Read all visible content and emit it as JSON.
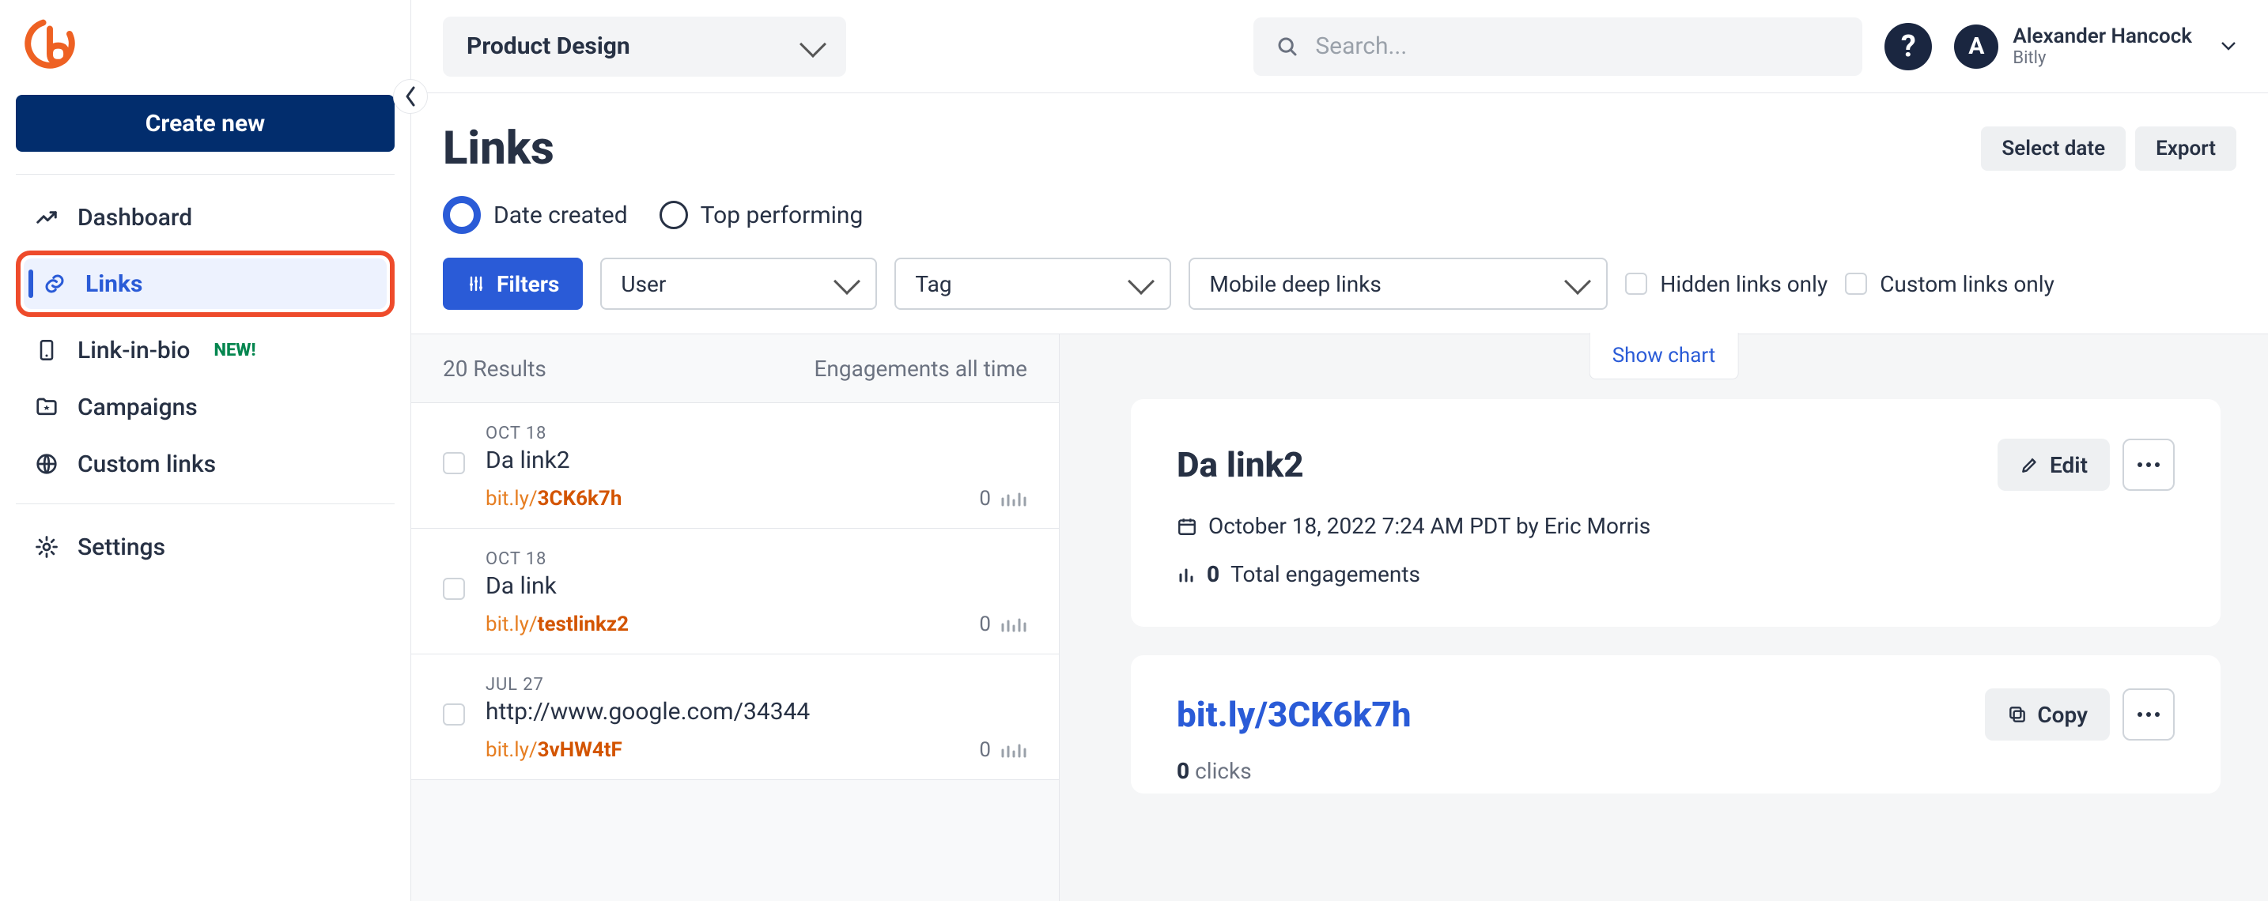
{
  "sidebar": {
    "create_label": "Create new",
    "nav": {
      "dashboard": "Dashboard",
      "links": "Links",
      "linkinbio": "Link-in-bio",
      "linkinbio_badge": "NEW!",
      "campaigns": "Campaigns",
      "custom": "Custom links",
      "settings": "Settings"
    }
  },
  "topbar": {
    "org": "Product Design",
    "search_placeholder": "Search...",
    "user_name": "Alexander Hancock",
    "user_org": "Bitly",
    "avatar_initial": "A"
  },
  "page": {
    "title": "Links",
    "select_date": "Select date",
    "export": "Export",
    "sort": {
      "date_created": "Date created",
      "top_performing": "Top performing"
    },
    "filters_btn": "Filters",
    "dropdowns": {
      "user": "User",
      "tag": "Tag",
      "mdl": "Mobile deep links"
    },
    "hidden_only": "Hidden links only",
    "custom_only": "Custom links only"
  },
  "list": {
    "results": "20 Results",
    "eng_header": "Engagements all time",
    "short_prefix": "bit.ly/",
    "items": [
      {
        "date": "OCT 18",
        "title": "Da link2",
        "key": "3CK6k7h",
        "eng": "0"
      },
      {
        "date": "OCT 18",
        "title": "Da link",
        "key": "testlinkz2",
        "eng": "0"
      },
      {
        "date": "JUL 27",
        "title": "http://www.google.com/34344",
        "key": "3vHW4tF",
        "eng": "0"
      }
    ]
  },
  "detail": {
    "show_chart": "Show chart",
    "title": "Da link2",
    "edit": "Edit",
    "created": "October 18, 2022 7:24 AM PDT by Eric Morris",
    "total_eng_n": "0",
    "total_eng_label": "Total engagements",
    "short_link": "bit.ly/3CK6k7h",
    "copy": "Copy",
    "clicks_n": "0",
    "clicks_label": "clicks"
  }
}
